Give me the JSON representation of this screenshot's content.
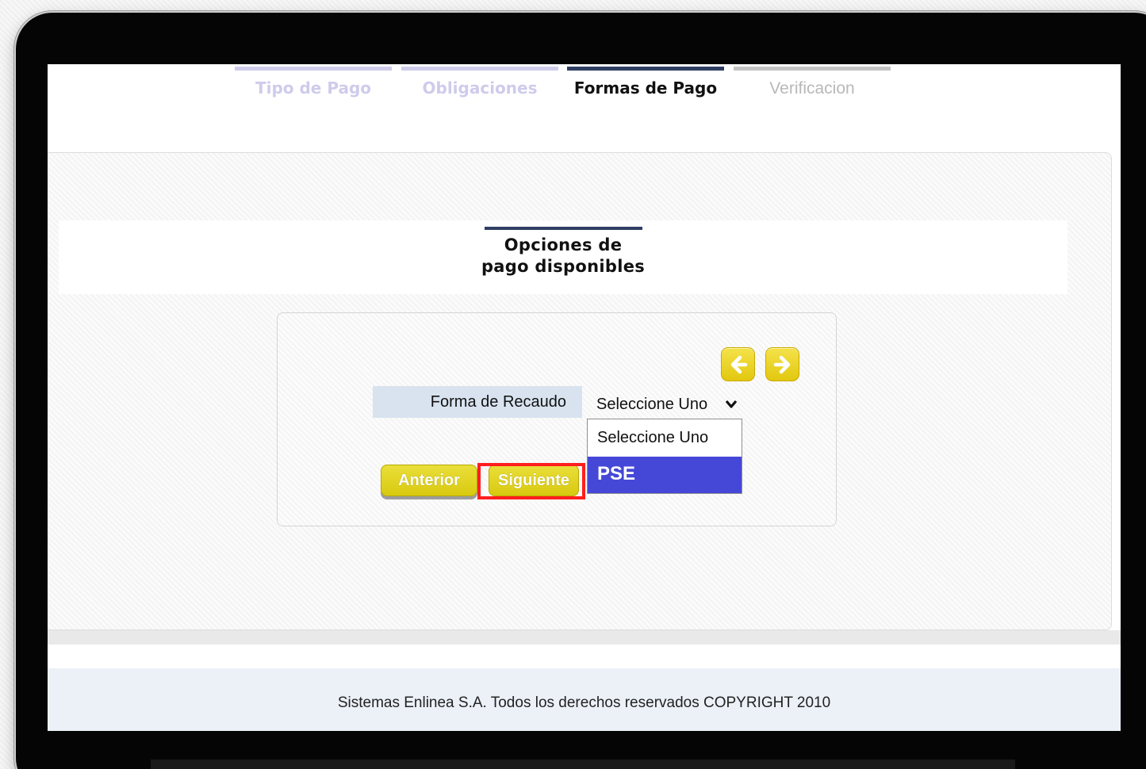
{
  "steps": [
    {
      "label": "Tipo de Pago",
      "state": "completed"
    },
    {
      "label": "Obligaciones",
      "state": "completed"
    },
    {
      "label": "Formas de Pago",
      "state": "active"
    },
    {
      "label": "Verificacion",
      "state": "pending"
    }
  ],
  "section": {
    "title_line1": "Opciones de",
    "title_line2": "pago disponibles"
  },
  "form": {
    "field_label": "Forma de Recaudo",
    "select_value": "Seleccione Uno",
    "options": [
      "Seleccione Uno",
      "PSE"
    ],
    "highlighted_option": "PSE",
    "prev_icon": "arrow-left-icon",
    "next_icon": "arrow-right-icon"
  },
  "buttons": {
    "previous_label": "Anterior",
    "next_label": "Siguiente"
  },
  "footer": {
    "text": "Sistemas Enlinea S.A. Todos los derechos reservados COPYRIGHT 2010"
  },
  "colors": {
    "accent_navy": "#2f3f63",
    "button_yellow": "#e2d21d",
    "selection_blue": "#4548d6",
    "annotation_red": "#ff1e1e"
  }
}
